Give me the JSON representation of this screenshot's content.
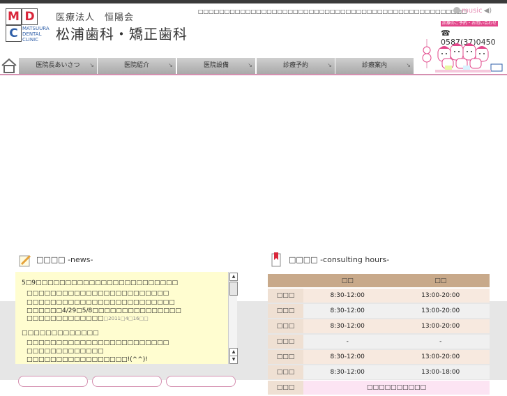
{
  "header": {
    "logo_letters": [
      "M",
      "D",
      "C"
    ],
    "logo_text": [
      "MATSUURA",
      "DENTAL",
      "CLINIC"
    ],
    "corporation": "医療法人　恒陽会",
    "clinic_name": "松浦歯科・矯正歯科",
    "tagline": "□□□□□□□□□□□□□□□□□□□□□□□□□□□□□□□□□□□□□□□□□□□□□□□□□□□",
    "music_label": "music",
    "reserve_badge": "診療のご予約・お問い合わせは",
    "phone": "☎ 0587(37)0450"
  },
  "nav": {
    "home_icon": "home-icon",
    "items": [
      {
        "label": "医院長あいさつ"
      },
      {
        "label": "医院紹介"
      },
      {
        "label": "医院設備"
      },
      {
        "label": "診療予約"
      },
      {
        "label": "診療案内"
      }
    ]
  },
  "news": {
    "title": "□□□□ -news-",
    "icon": "pencil-note-icon",
    "items": [
      {
        "heading": "5□9□□□□□□□□□□□□□□□□□□□□□□□□",
        "lines": [
          "□□□□□□□□□□□□□□□□□□□□□□□□",
          "□□□□□□□□□□□□□□□□□□□□□□□□□",
          "□□□□□□4/29□5/8□□□□□□□□□□□□□□□",
          "□□□□□□□□□□□□□"
        ],
        "date": "□2011□4□16□□"
      },
      {
        "heading": "□□□□□□□□□□□□□",
        "lines": [
          "□□□□□□□□□□□□□□□□□□□□□□□□",
          "□□□□□□□□□□□□□",
          "□□□□□□□□□□□□□□□□□!(^^)!"
        ]
      }
    ]
  },
  "hours": {
    "title": "□□□□ -consulting hours-",
    "icon": "bookmark-icon",
    "columns": [
      "",
      "□□",
      "□□"
    ],
    "rows": [
      {
        "day": "□□□",
        "am": "8:30-12:00",
        "pm": "13:00-20:00"
      },
      {
        "day": "□□□",
        "am": "8:30-12:00",
        "pm": "13:00-20:00"
      },
      {
        "day": "□□□",
        "am": "8:30-12:00",
        "pm": "13:00-20:00"
      },
      {
        "day": "□□□",
        "am": "-",
        "pm": "-"
      },
      {
        "day": "□□□",
        "am": "8:30-12:00",
        "pm": "13:00-20:00"
      },
      {
        "day": "□□□",
        "am": "8:30-12:00",
        "pm": "13:00-18:00"
      }
    ],
    "last_row": {
      "day": "□□□",
      "note": "□□□□□□□□□□"
    }
  },
  "colors": {
    "accent_pink": "#d58fb0",
    "badge_pink": "#e2468a",
    "logo_red": "#d9263a",
    "logo_blue": "#2f5fa8",
    "table_header": "#c8a98a",
    "news_bg": "#fffdd0"
  }
}
